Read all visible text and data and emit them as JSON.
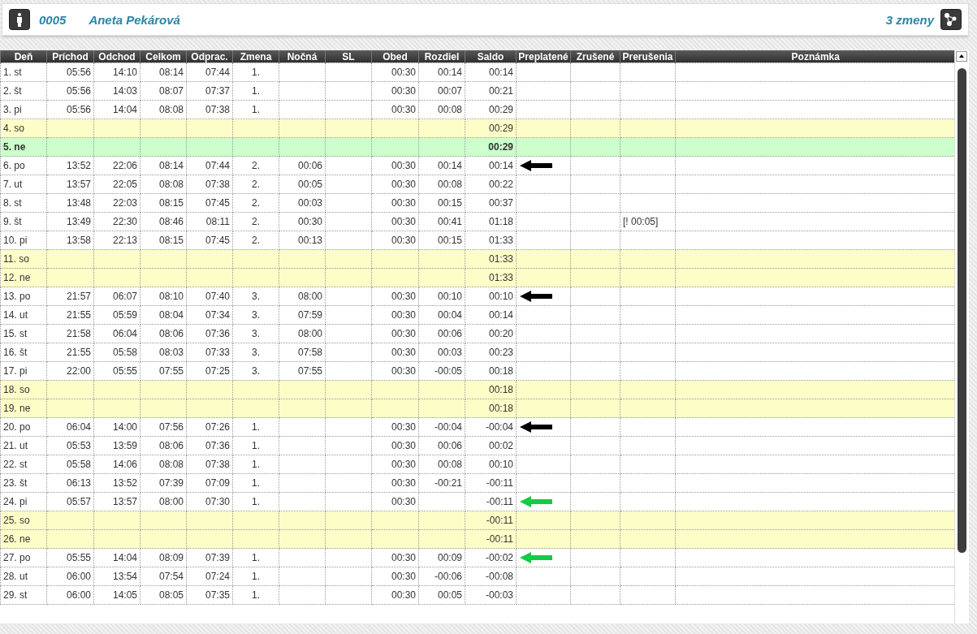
{
  "header": {
    "employee_id": "0005",
    "employee_name": "Aneta Pekárová",
    "shifts_link": "3 zmeny"
  },
  "table": {
    "columns": [
      "Deň",
      "Príchod",
      "Odchod",
      "Celkom",
      "Odprac.",
      "Zmena",
      "Nočná",
      "SL",
      "Obed",
      "Rozdiel",
      "Saldo",
      "Preplatené",
      "Zrušené",
      "Prerušenia",
      "Poznámka"
    ],
    "rows": [
      {
        "kind": "workday",
        "cells": [
          "1. st",
          "05:56",
          "14:10",
          "08:14",
          "07:44",
          "1.",
          null,
          null,
          "00:30",
          "00:14",
          "00:14",
          null,
          null,
          null,
          null
        ]
      },
      {
        "kind": "workday",
        "cells": [
          "2. št",
          "05:56",
          "14:03",
          "08:07",
          "07:37",
          "1.",
          null,
          null,
          "00:30",
          "00:07",
          "00:21",
          null,
          null,
          null,
          null
        ]
      },
      {
        "kind": "workday",
        "cells": [
          "3. pi",
          "05:56",
          "14:04",
          "08:08",
          "07:38",
          "1.",
          null,
          null,
          "00:30",
          "00:08",
          "00:29",
          null,
          null,
          null,
          null
        ]
      },
      {
        "kind": "weekend",
        "cells": [
          "4. so",
          null,
          null,
          null,
          null,
          null,
          null,
          null,
          null,
          null,
          "00:29",
          null,
          null,
          null,
          null
        ]
      },
      {
        "kind": "holiday",
        "cells": [
          "5. ne",
          null,
          null,
          null,
          null,
          null,
          null,
          null,
          null,
          null,
          "00:29",
          null,
          null,
          null,
          null
        ]
      },
      {
        "kind": "workday",
        "arrow": {
          "color": "#000000"
        },
        "cells": [
          "6. po",
          "13:52",
          "22:06",
          "08:14",
          "07:44",
          "2.",
          "00:06",
          null,
          "00:30",
          "00:14",
          "00:14",
          null,
          null,
          null,
          null
        ]
      },
      {
        "kind": "workday",
        "cells": [
          "7. ut",
          "13:57",
          "22:05",
          "08:08",
          "07:38",
          "2.",
          "00:05",
          null,
          "00:30",
          "00:08",
          "00:22",
          null,
          null,
          null,
          null
        ]
      },
      {
        "kind": "workday",
        "cells": [
          "8. st",
          "13:48",
          "22:03",
          "08:15",
          "07:45",
          "2.",
          "00:03",
          null,
          "00:30",
          "00:15",
          "00:37",
          null,
          null,
          null,
          null
        ]
      },
      {
        "kind": "workday",
        "cells": [
          "9. št",
          "13:49",
          "22:30",
          "08:46",
          "08:11",
          "2.",
          "00:30",
          null,
          "00:30",
          "00:41",
          "01:18",
          null,
          null,
          "[! 00:05]",
          null
        ]
      },
      {
        "kind": "workday",
        "cells": [
          "10. pi",
          "13:58",
          "22:13",
          "08:15",
          "07:45",
          "2.",
          "00:13",
          null,
          "00:30",
          "00:15",
          "01:33",
          null,
          null,
          null,
          null
        ]
      },
      {
        "kind": "weekend",
        "cells": [
          "11. so",
          null,
          null,
          null,
          null,
          null,
          null,
          null,
          null,
          null,
          "01:33",
          null,
          null,
          null,
          null
        ]
      },
      {
        "kind": "weekend",
        "cells": [
          "12. ne",
          null,
          null,
          null,
          null,
          null,
          null,
          null,
          null,
          null,
          "01:33",
          null,
          null,
          null,
          null
        ]
      },
      {
        "kind": "workday",
        "arrow": {
          "color": "#000000"
        },
        "cells": [
          "13. po",
          "21:57",
          "06:07",
          "08:10",
          "07:40",
          "3.",
          "08:00",
          null,
          "00:30",
          "00:10",
          "00:10",
          null,
          null,
          null,
          null
        ]
      },
      {
        "kind": "workday",
        "cells": [
          "14. ut",
          "21:55",
          "05:59",
          "08:04",
          "07:34",
          "3.",
          "07:59",
          null,
          "00:30",
          "00:04",
          "00:14",
          null,
          null,
          null,
          null
        ]
      },
      {
        "kind": "workday",
        "cells": [
          "15. st",
          "21:58",
          "06:04",
          "08:06",
          "07:36",
          "3.",
          "08:00",
          null,
          "00:30",
          "00:06",
          "00:20",
          null,
          null,
          null,
          null
        ]
      },
      {
        "kind": "workday",
        "cells": [
          "16. št",
          "21:55",
          "05:58",
          "08:03",
          "07:33",
          "3.",
          "07:58",
          null,
          "00:30",
          "00:03",
          "00:23",
          null,
          null,
          null,
          null
        ]
      },
      {
        "kind": "workday",
        "cells": [
          "17. pi",
          "22:00",
          "05:55",
          "07:55",
          "07:25",
          "3.",
          "07:55",
          null,
          "00:30",
          "-00:05",
          "00:18",
          null,
          null,
          null,
          null
        ]
      },
      {
        "kind": "weekend",
        "cells": [
          "18. so",
          null,
          null,
          null,
          null,
          null,
          null,
          null,
          null,
          null,
          "00:18",
          null,
          null,
          null,
          null
        ]
      },
      {
        "kind": "weekend",
        "cells": [
          "19. ne",
          null,
          null,
          null,
          null,
          null,
          null,
          null,
          null,
          null,
          "00:18",
          null,
          null,
          null,
          null
        ]
      },
      {
        "kind": "workday",
        "arrow": {
          "color": "#000000"
        },
        "cells": [
          "20. po",
          "06:04",
          "14:00",
          "07:56",
          "07:26",
          "1.",
          null,
          null,
          "00:30",
          "-00:04",
          "-00:04",
          null,
          null,
          null,
          null
        ]
      },
      {
        "kind": "workday",
        "cells": [
          "21. ut",
          "05:53",
          "13:59",
          "08:06",
          "07:36",
          "1.",
          null,
          null,
          "00:30",
          "00:06",
          "00:02",
          null,
          null,
          null,
          null
        ]
      },
      {
        "kind": "workday",
        "cells": [
          "22. st",
          "05:58",
          "14:06",
          "08:08",
          "07:38",
          "1.",
          null,
          null,
          "00:30",
          "00:08",
          "00:10",
          null,
          null,
          null,
          null
        ]
      },
      {
        "kind": "workday",
        "cells": [
          "23. št",
          "06:13",
          "13:52",
          "07:39",
          "07:09",
          "1.",
          null,
          null,
          "00:30",
          "-00:21",
          "-00:11",
          null,
          null,
          null,
          null
        ]
      },
      {
        "kind": "workday",
        "arrow": {
          "color": "#11cc44"
        },
        "cells": [
          "24. pi",
          "05:57",
          "13:57",
          "08:00",
          "07:30",
          "1.",
          null,
          null,
          "00:30",
          null,
          "-00:11",
          null,
          null,
          null,
          null
        ]
      },
      {
        "kind": "weekend",
        "cells": [
          "25. so",
          null,
          null,
          null,
          null,
          null,
          null,
          null,
          null,
          null,
          "-00:11",
          null,
          null,
          null,
          null
        ]
      },
      {
        "kind": "weekend",
        "cells": [
          "26. ne",
          null,
          null,
          null,
          null,
          null,
          null,
          null,
          null,
          null,
          "-00:11",
          null,
          null,
          null,
          null
        ]
      },
      {
        "kind": "workday",
        "arrow": {
          "color": "#11cc44"
        },
        "cells": [
          "27. po",
          "05:55",
          "14:04",
          "08:09",
          "07:39",
          "1.",
          null,
          null,
          "00:30",
          "00:09",
          "-00:02",
          null,
          null,
          null,
          null
        ]
      },
      {
        "kind": "workday",
        "cells": [
          "28. ut",
          "06:00",
          "13:54",
          "07:54",
          "07:24",
          "1.",
          null,
          null,
          "00:30",
          "-00:06",
          "-00:08",
          null,
          null,
          null,
          null
        ]
      },
      {
        "kind": "workday",
        "cells": [
          "29. st",
          "06:00",
          "14:05",
          "08:05",
          "07:35",
          "1.",
          null,
          null,
          "00:30",
          "00:05",
          "-00:03",
          null,
          null,
          null,
          null
        ]
      }
    ]
  }
}
